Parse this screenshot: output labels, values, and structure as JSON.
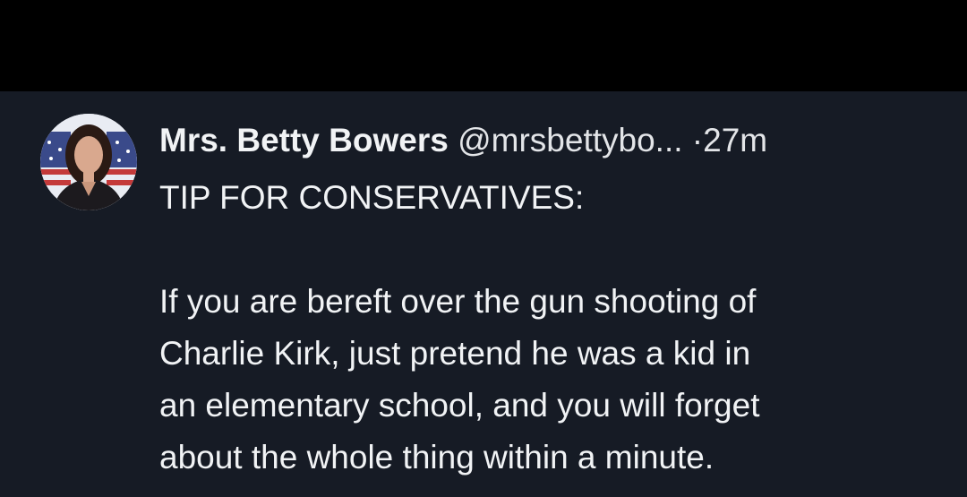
{
  "tweet": {
    "author": {
      "display_name": "Mrs. Betty Bowers",
      "handle": "@mrsbettybo...",
      "avatar_icon": "profile-photo-avatar"
    },
    "separator": "·",
    "timestamp": "27m",
    "text": {
      "title_line": "TIP FOR CONSERVATIVES:",
      "lines": [
        "If you are bereft over the gun shooting of",
        "Charlie Kirk, just pretend he was a kid in",
        "an elementary school, and you will forget",
        "about the whole thing within a minute."
      ]
    }
  },
  "colors": {
    "top_bar": "#000000",
    "background": "#161b25",
    "text": "#f1f3f5"
  }
}
